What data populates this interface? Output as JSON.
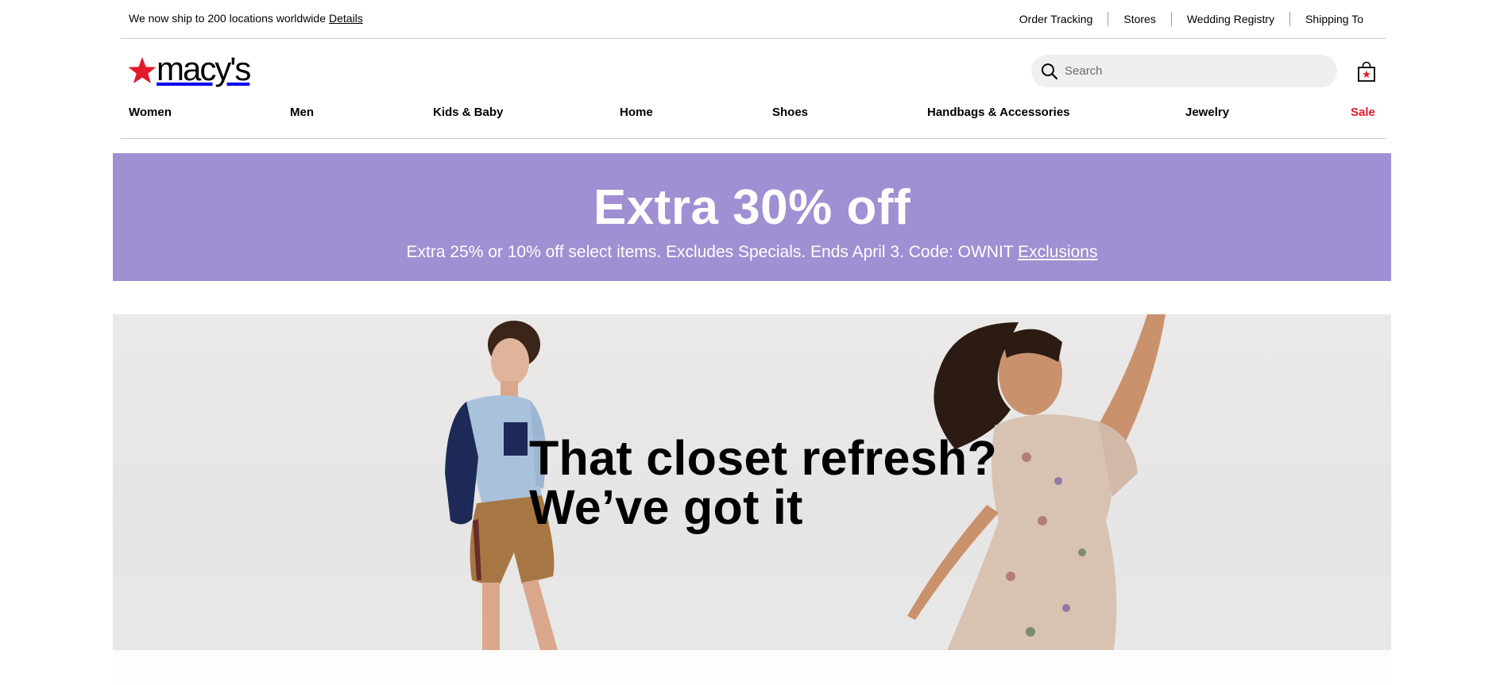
{
  "utility": {
    "ship_message": "We now ship to 200 locations worldwide",
    "details_link": "Details",
    "links": [
      "Order Tracking",
      "Stores",
      "Wedding Registry",
      "Shipping To"
    ]
  },
  "header": {
    "logo_text": "macy's",
    "search_placeholder": "Search"
  },
  "nav": {
    "items": [
      "Women",
      "Men",
      "Kids & Baby",
      "Home",
      "Shoes",
      "Handbags & Accessories",
      "Jewelry",
      "Sale"
    ]
  },
  "promo": {
    "title": "Extra 30% off",
    "subtitle": "Extra 25% or 10% off select items.  Excludes Specials. Ends April 3. Code: OWNIT",
    "exclusions_link": "Exclusions",
    "background_color": "#a08fd2"
  },
  "hero": {
    "headline_line1": "That closet refresh?",
    "headline_line2": "We’ve got it"
  },
  "colors": {
    "brand_red": "#e21a2c",
    "promo_purple": "#a08fd2"
  },
  "icons": {
    "search": "search-icon",
    "bag": "shopping-bag-icon",
    "logo_star": "star-icon"
  }
}
